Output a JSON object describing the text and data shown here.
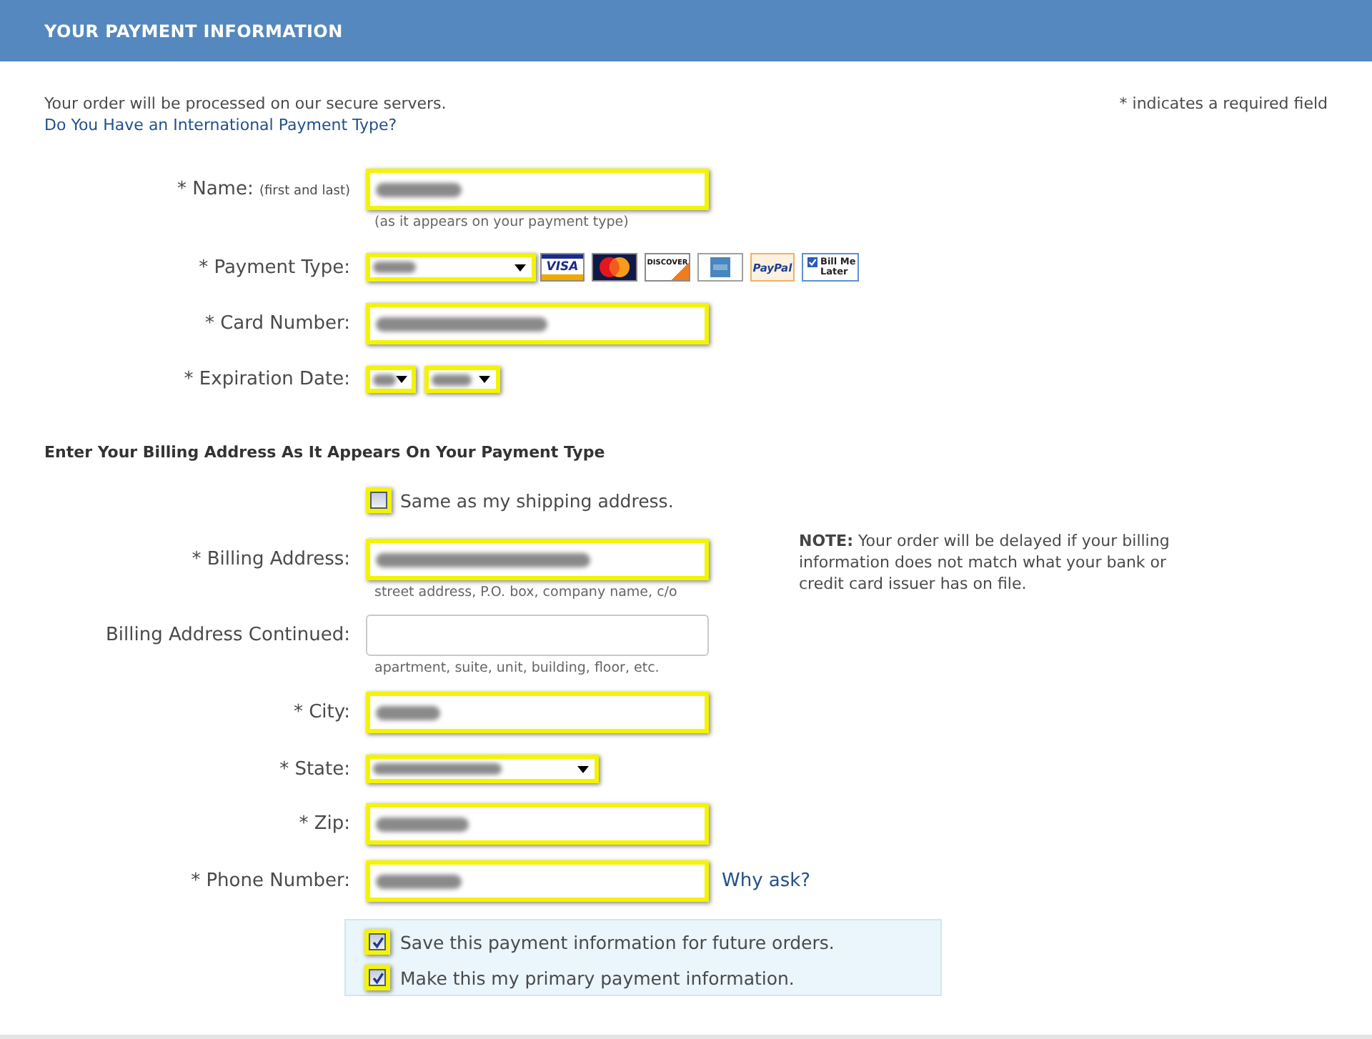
{
  "header": {
    "title": "YOUR PAYMENT INFORMATION"
  },
  "intro": {
    "secure_note": "Your order will be processed on our secure servers.",
    "international_link": "Do You Have an International Payment Type?",
    "required_note": "* indicates a required field"
  },
  "payment_fields": [
    {
      "kind": "text",
      "label": "* Name:",
      "label_note": "(first and last)",
      "highlighted": true,
      "blurred": true,
      "hint": "(as it appears on your payment type)"
    },
    {
      "kind": "select",
      "label": "* Payment Type:",
      "highlighted": true,
      "blurred": true,
      "card_logos": [
        {
          "kind": "banded",
          "text": "VISA"
        },
        {
          "kind": "circles"
        },
        {
          "kind": "corner",
          "text": "DISCOVER"
        },
        {
          "kind": "tile"
        },
        {
          "kind": "script",
          "text": "PayPal"
        },
        {
          "kind": "check",
          "text": "Bill Me Later"
        }
      ]
    },
    {
      "kind": "text",
      "label": "* Card Number:",
      "highlighted": true,
      "blurred": true
    },
    {
      "kind": "dates",
      "label": "* Expiration Date:",
      "selects": [
        {
          "highlighted": true,
          "blurred": true
        },
        {
          "highlighted": true,
          "blurred": true
        }
      ]
    }
  ],
  "billing": {
    "heading": "Enter Your Billing Address As It Appears On Your Payment Type",
    "same_as_shipping": {
      "label": "Same as my shipping address.",
      "checked": false,
      "highlighted": true
    },
    "fields": [
      {
        "kind": "text",
        "label": "* Billing Address:",
        "highlighted": true,
        "blurred": true,
        "hint": "street address, P.O. box, company name, c/o",
        "note": "**NOTE:** Your order will be delayed if your billing information does not match what your bank or credit card issuer has on file."
      },
      {
        "kind": "text",
        "label": "Billing Address Continued:",
        "highlighted": false,
        "blurred": false,
        "hint": "apartment, suite, unit, building, floor, etc."
      },
      {
        "kind": "text",
        "label": "* City:",
        "highlighted": true,
        "blurred": true
      },
      {
        "kind": "select",
        "label": "* State:",
        "highlighted": true,
        "blurred": true
      },
      {
        "kind": "text",
        "label": "* Zip:",
        "highlighted": true,
        "blurred": true
      },
      {
        "kind": "text",
        "label": "* Phone Number:",
        "highlighted": true,
        "blurred": true,
        "link": "Why ask?"
      }
    ]
  },
  "options": [
    {
      "label": "Save this payment information for future orders.",
      "checked": true,
      "highlighted": true
    },
    {
      "label": "Make this my primary payment information.",
      "checked": true,
      "highlighted": true
    }
  ]
}
